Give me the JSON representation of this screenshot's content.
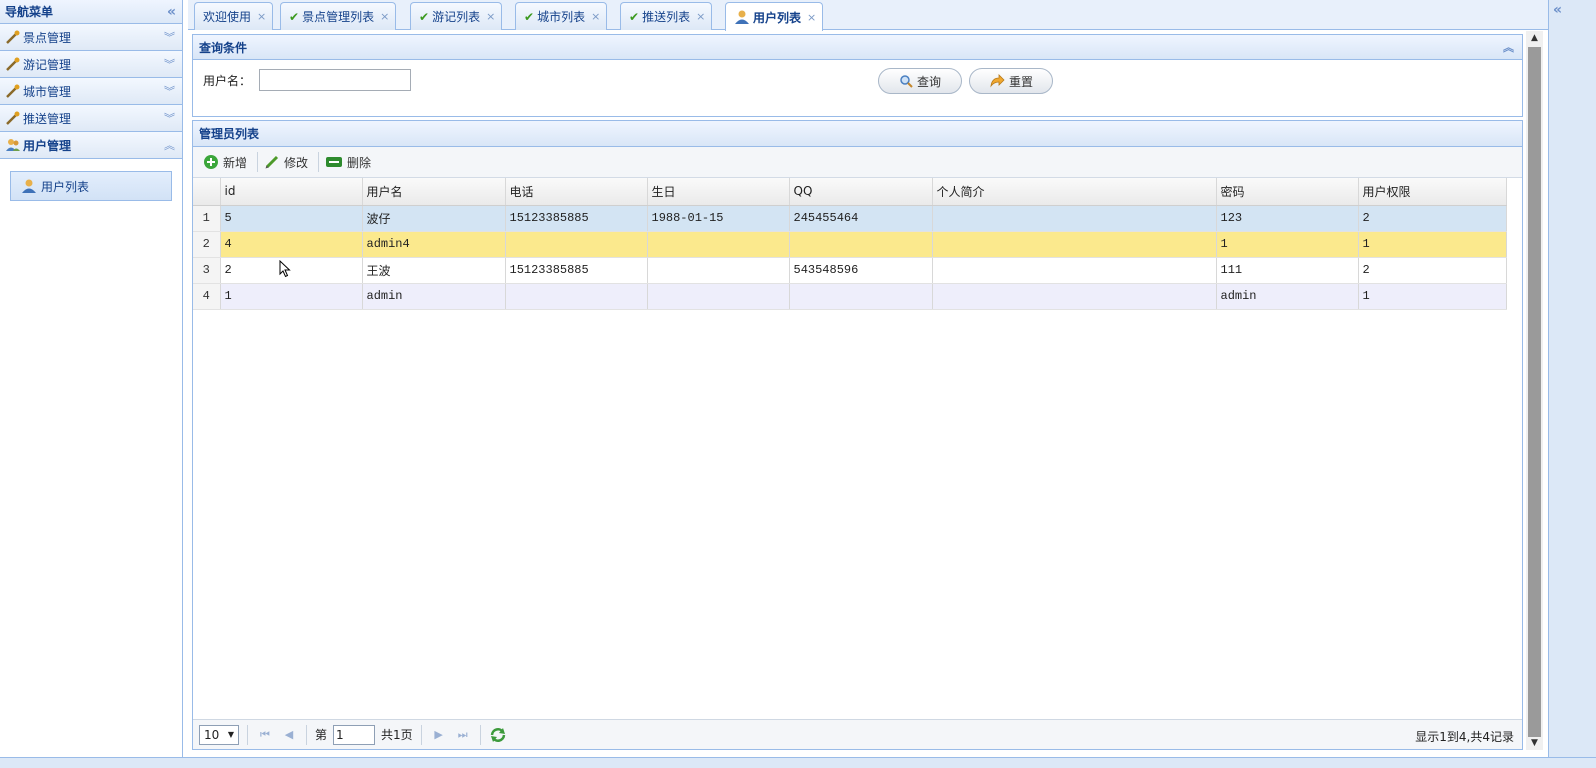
{
  "nav": {
    "title": "导航菜单",
    "sections": [
      {
        "label": "景点管理"
      },
      {
        "label": "游记管理"
      },
      {
        "label": "城市管理"
      },
      {
        "label": "推送管理"
      },
      {
        "label": "用户管理"
      }
    ],
    "items": [
      {
        "label": "用户列表"
      }
    ]
  },
  "tabs": [
    {
      "label": "欢迎使用"
    },
    {
      "label": "景点管理列表"
    },
    {
      "label": "游记列表"
    },
    {
      "label": "城市列表"
    },
    {
      "label": "推送列表"
    },
    {
      "label": "用户列表"
    }
  ],
  "search": {
    "title": "查询条件",
    "username_label": "用户名：",
    "username_value": "",
    "query_label": "查询",
    "reset_label": "重置"
  },
  "grid": {
    "title": "管理员列表",
    "toolbar": {
      "add": "新增",
      "edit": "修改",
      "delete": "删除"
    },
    "columns": [
      "id",
      "用户名",
      "电话",
      "生日",
      "QQ",
      "个人简介",
      "密码",
      "用户权限"
    ],
    "rows": [
      {
        "rn": "1",
        "id": "5",
        "username": "波仔",
        "phone": "15123385885",
        "birthday": "1988-01-15",
        "qq": "245455464",
        "bio": "",
        "password": "123",
        "perm": "2"
      },
      {
        "rn": "2",
        "id": "4",
        "username": "admin4",
        "phone": "",
        "birthday": "",
        "qq": "",
        "bio": "",
        "password": "1",
        "perm": "1"
      },
      {
        "rn": "3",
        "id": "2",
        "username": "王波",
        "phone": "15123385885",
        "birthday": "",
        "qq": "543548596",
        "bio": "",
        "password": "111",
        "perm": "2"
      },
      {
        "rn": "4",
        "id": "1",
        "username": "admin",
        "phone": "",
        "birthday": "",
        "qq": "",
        "bio": "",
        "password": "admin",
        "perm": "1"
      }
    ]
  },
  "pager": {
    "page_size": "10",
    "page_prefix": "第",
    "page_value": "1",
    "total_pages": "共1页",
    "info": "显示1到4,共4记录"
  },
  "colors": {
    "accent": "#15428b",
    "border": "#99bbe8",
    "selected_row": "#d3e4f3",
    "highlight_row": "#fbe98d"
  }
}
